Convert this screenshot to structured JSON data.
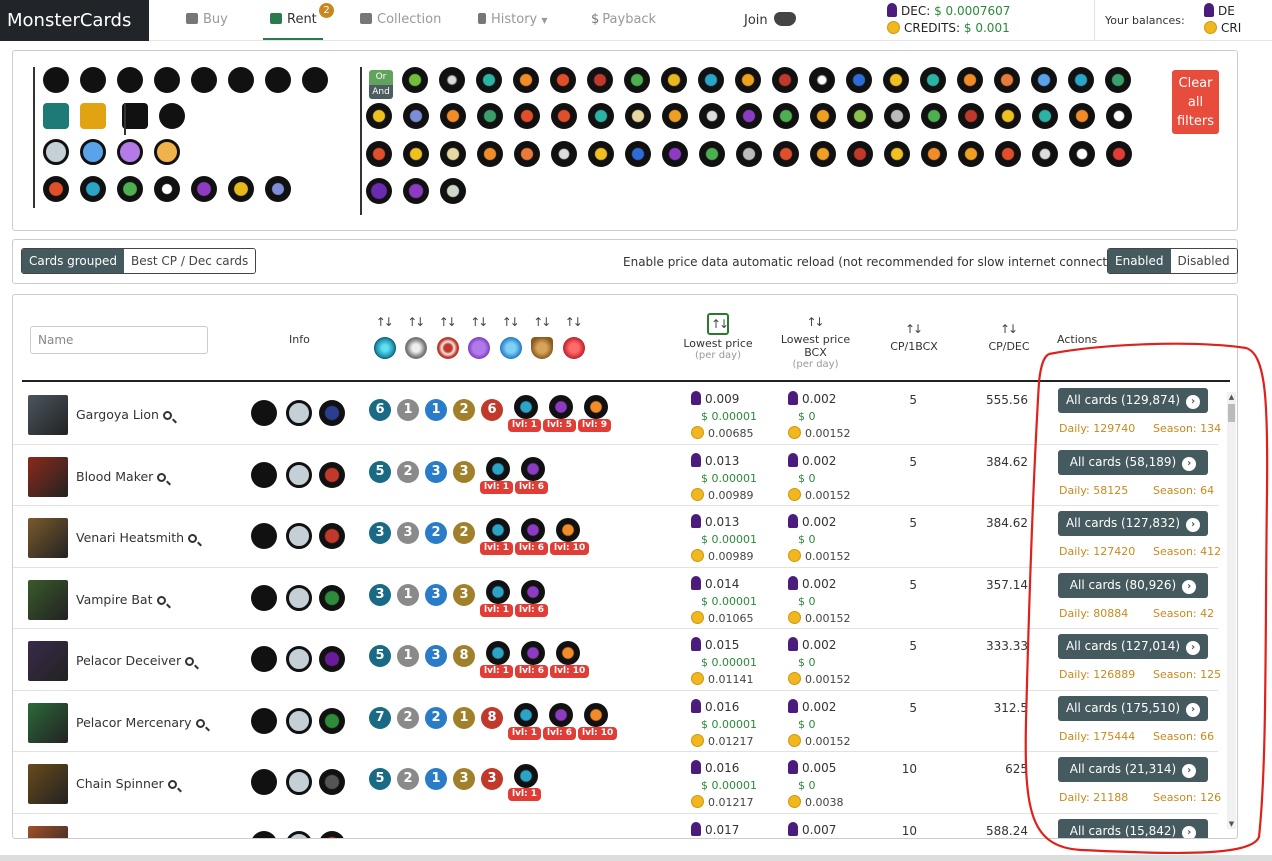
{
  "nav": {
    "brand": "MonsterCards",
    "items": [
      {
        "label": "Buy",
        "icon": "shop-icon"
      },
      {
        "label": "Rent",
        "icon": "store-icon",
        "badge": "2"
      },
      {
        "label": "Collection",
        "icon": "folder-icon"
      },
      {
        "label": "History",
        "icon": "hourglass-icon"
      },
      {
        "label": "Payback",
        "icon": "dollar-icon"
      }
    ],
    "join": "Join",
    "dec_label": "DEC:",
    "dec_value": "$ 0.0007607",
    "credits_label": "CREDITS:",
    "credits_value": "$ 0.001",
    "balances_label": "Your balances:",
    "balance_dec": "DE",
    "balance_credits": "CRI"
  },
  "filters": {
    "or": "Or",
    "and": "And",
    "clear_label": "Clear all filters"
  },
  "options": {
    "grouped": "Cards grouped",
    "best": "Best CP / Dec cards",
    "reload_text": "Enable price data automatic reload (not recommended for slow internet connection)",
    "enabled": "Enabled",
    "disabled": "Disabled"
  },
  "table": {
    "name_placeholder": "Name",
    "info": "Info",
    "lowest_price": "Lowest price",
    "lowest_price_sub": "(per day)",
    "lowest_bcx": "Lowest price BCX",
    "lowest_bcx_sub": "(per day)",
    "cp_bcx": "CP/1BCX",
    "cp_dec": "CP/DEC",
    "actions": "Actions",
    "daily_prefix": "Daily: ",
    "season_prefix": "Season: ",
    "rows": [
      {
        "name": "Gargoya Lion",
        "stats": [
          "6",
          "1",
          "1",
          "2",
          "6"
        ],
        "abil": [
          "lvl: 1",
          "lvl: 5",
          "lvl: 9"
        ],
        "dec": "0.009",
        "usd": "$ 0.00001",
        "cr": "0.00685",
        "bdec": "0.002",
        "busd": "$ 0",
        "bcr": "0.00152",
        "cpbcx": "5",
        "cpdec": "555.56",
        "btn": "All cards (129,874)",
        "daily": "Daily: 129740",
        "season": "Season: 134",
        "el": "#2c3e8f"
      },
      {
        "name": "Blood Maker",
        "stats": [
          "5",
          "2",
          "3",
          "3"
        ],
        "abil": [
          "lvl: 1",
          "lvl: 6"
        ],
        "dec": "0.013",
        "usd": "$ 0.00001",
        "cr": "0.00989",
        "bdec": "0.002",
        "busd": "$ 0",
        "bcr": "0.00152",
        "cpbcx": "5",
        "cpdec": "384.62",
        "btn": "All cards (58,189)",
        "daily": "Daily: 58125",
        "season": "Season: 64",
        "el": "#c0392b"
      },
      {
        "name": "Venari Heatsmith",
        "stats": [
          "3",
          "3",
          "2",
          "2"
        ],
        "abil": [
          "lvl: 1",
          "lvl: 6",
          "lvl: 10"
        ],
        "dec": "0.013",
        "usd": "$ 0.00001",
        "cr": "0.00989",
        "bdec": "0.002",
        "busd": "$ 0",
        "bcr": "0.00152",
        "cpbcx": "5",
        "cpdec": "384.62",
        "btn": "All cards (127,832)",
        "daily": "Daily: 127420",
        "season": "Season: 412",
        "el": "#c0392b"
      },
      {
        "name": "Vampire Bat",
        "stats": [
          "3",
          "1",
          "3",
          "3"
        ],
        "abil": [
          "lvl: 1",
          "lvl: 6"
        ],
        "dec": "0.014",
        "usd": "$ 0.00001",
        "cr": "0.01065",
        "bdec": "0.002",
        "busd": "$ 0",
        "bcr": "0.00152",
        "cpbcx": "5",
        "cpdec": "357.14",
        "btn": "All cards (80,926)",
        "daily": "Daily: 80884",
        "season": "Season: 42",
        "el": "#2e8b3a"
      },
      {
        "name": "Pelacor Deceiver",
        "stats": [
          "5",
          "1",
          "3",
          "8"
        ],
        "abil": [
          "lvl: 1",
          "lvl: 6",
          "lvl: 10"
        ],
        "dec": "0.015",
        "usd": "$ 0.00001",
        "cr": "0.01141",
        "bdec": "0.002",
        "busd": "$ 0",
        "bcr": "0.00152",
        "cpbcx": "5",
        "cpdec": "333.33",
        "btn": "All cards (127,014)",
        "daily": "Daily: 126889",
        "season": "Season: 125",
        "el": "#6a1b9a"
      },
      {
        "name": "Pelacor Mercenary",
        "stats": [
          "7",
          "2",
          "2",
          "1",
          "8"
        ],
        "abil": [
          "lvl: 1",
          "lvl: 6",
          "lvl: 10"
        ],
        "dec": "0.016",
        "usd": "$ 0.00001",
        "cr": "0.01217",
        "bdec": "0.002",
        "busd": "$ 0",
        "bcr": "0.00152",
        "cpbcx": "5",
        "cpdec": "312.5",
        "btn": "All cards (175,510)",
        "daily": "Daily: 175444",
        "season": "Season: 66",
        "el": "#2e8b3a"
      },
      {
        "name": "Chain Spinner",
        "stats": [
          "5",
          "2",
          "1",
          "3",
          "3"
        ],
        "abil": [
          "lvl: 1"
        ],
        "dec": "0.016",
        "usd": "$ 0.00001",
        "cr": "0.01217",
        "bdec": "0.005",
        "busd": "$ 0",
        "bcr": "0.0038",
        "cpbcx": "10",
        "cpdec": "625",
        "btn": "All cards (21,314)",
        "daily": "Daily: 21188",
        "season": "Season: 126",
        "el": "#555"
      },
      {
        "name": "",
        "stats": [],
        "abil": [],
        "dec": "0.017",
        "usd": "",
        "cr": "",
        "bdec": "0.007",
        "busd": "",
        "bcr": "",
        "cpbcx": "10",
        "cpdec": "588.24",
        "btn": "All cards (15,842)",
        "daily": "",
        "season": "",
        "el": "#c0392b"
      }
    ]
  },
  "colors": {
    "accent": "#455a5e",
    "gold": "#c8891e",
    "red": "#e74c3c",
    "green": "#2a8a39"
  }
}
